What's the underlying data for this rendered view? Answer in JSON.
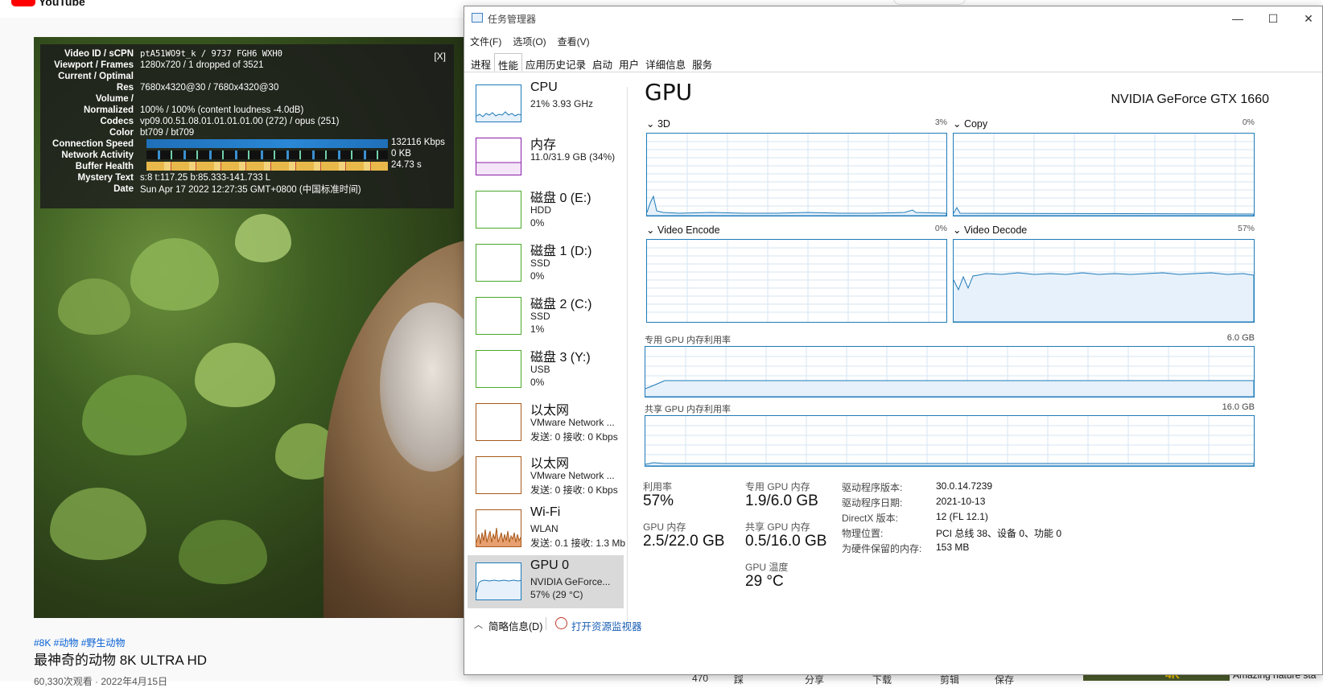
{
  "youtube": {
    "logo_text": "YouTube",
    "tags": "#8K #动物 #野生动物",
    "video_title": "最神奇的动物 8K ULTRA HD",
    "meta": "60,330次观看 · 2022年4月15日",
    "actions": {
      "likes": "470",
      "dislike": "踩",
      "share": "分享",
      "download": "下载",
      "clip": "剪辑",
      "save": "保存"
    },
    "suggested_title": "Amazing nature sta",
    "suggested_badge": "4K",
    "stats_overlay": {
      "close": "[X]",
      "rows": [
        {
          "label": "Video ID / sCPN",
          "value": "ptA51WO9t_k / 9737 FGH6 WXH0"
        },
        {
          "label": "Viewport / Frames",
          "value": "1280x720 / 1 dropped of 3521"
        },
        {
          "label": "Current / Optimal",
          "value": ""
        },
        {
          "label": "Res",
          "value": "7680x4320@30 / 7680x4320@30"
        },
        {
          "label": "Volume /",
          "value": ""
        },
        {
          "label": "Normalized",
          "value": "100% / 100% (content loudness -4.0dB)"
        },
        {
          "label": "Codecs",
          "value": "vp09.00.51.08.01.01.01.01.00 (272) / opus (251)"
        },
        {
          "label": "Color",
          "value": "bt709 / bt709"
        },
        {
          "label": "Connection Speed",
          "value": "132116 Kbps"
        },
        {
          "label": "Network Activity",
          "value": "0 KB"
        },
        {
          "label": "Buffer Health",
          "value": "24.73 s"
        },
        {
          "label": "Mystery Text",
          "value": "s:8 t:117.25 b:85.333-141.733 L"
        },
        {
          "label": "Date",
          "value": "Sun Apr 17 2022 12:27:35 GMT+0800 (中国标准时间)"
        }
      ]
    }
  },
  "taskmgr": {
    "title": "任务管理器",
    "window_buttons": {
      "minimize": "—",
      "maximize": "☐",
      "close": "✕"
    },
    "menu": [
      "文件(F)",
      "选项(O)",
      "查看(V)"
    ],
    "tabs": [
      "进程",
      "性能",
      "应用历史记录",
      "启动",
      "用户",
      "详细信息",
      "服务"
    ],
    "active_tab": "性能",
    "resources": [
      {
        "name": "CPU",
        "lines": [
          "21% 3.93 GHz"
        ],
        "color": "#1e7ab8"
      },
      {
        "name": "内存",
        "lines": [
          "11.0/31.9 GB (34%)"
        ],
        "color": "#8b1ea8"
      },
      {
        "name": "磁盘 0 (E:)",
        "lines": [
          "HDD",
          "0%"
        ],
        "color": "#4aa82a"
      },
      {
        "name": "磁盘 1 (D:)",
        "lines": [
          "SSD",
          "0%"
        ],
        "color": "#4aa82a"
      },
      {
        "name": "磁盘 2 (C:)",
        "lines": [
          "SSD",
          "1%"
        ],
        "color": "#4aa82a"
      },
      {
        "name": "磁盘 3 (Y:)",
        "lines": [
          "USB",
          "0%"
        ],
        "color": "#4aa82a"
      },
      {
        "name": "以太网",
        "lines": [
          "VMware Network ...",
          "发送: 0 接收: 0 Kbps"
        ],
        "color": "#a75a1c"
      },
      {
        "name": "以太网",
        "lines": [
          "VMware Network ...",
          "发送: 0 接收: 0 Kbps"
        ],
        "color": "#a75a1c"
      },
      {
        "name": "Wi-Fi",
        "lines": [
          "WLAN",
          "发送: 0.1 接收: 1.3 Mb"
        ],
        "color": "#a75a1c"
      },
      {
        "name": "GPU 0",
        "lines": [
          "NVIDIA GeForce...",
          "57% (29 °C)"
        ],
        "color": "#1e7ab8"
      }
    ],
    "gpu": {
      "heading": "GPU",
      "model": "NVIDIA GeForce GTX 1660",
      "engines": [
        {
          "label": "3D",
          "pct": "3%"
        },
        {
          "label": "Copy",
          "pct": "0%"
        },
        {
          "label": "Video Encode",
          "pct": "0%"
        },
        {
          "label": "Video Decode",
          "pct": "57%"
        }
      ],
      "dedicated_label": "专用 GPU 内存利用率",
      "dedicated_max": "6.0 GB",
      "shared_label": "共享 GPU 内存利用率",
      "shared_max": "16.0 GB",
      "stats": {
        "utilization_k": "利用率",
        "utilization_v": "57%",
        "dedicated_k": "专用 GPU 内存",
        "dedicated_v": "1.9/6.0 GB",
        "gpu_mem_k": "GPU 内存",
        "gpu_mem_v": "2.5/22.0 GB",
        "shared_k": "共享 GPU 内存",
        "shared_v": "0.5/16.0 GB",
        "temp_k": "GPU 温度",
        "temp_v": "29 °C"
      },
      "info": [
        {
          "k": "驱动程序版本:",
          "v": "30.0.14.7239"
        },
        {
          "k": "驱动程序日期:",
          "v": "2021-10-13"
        },
        {
          "k": "DirectX 版本:",
          "v": "12 (FL 12.1)"
        },
        {
          "k": "物理位置:",
          "v": "PCI 总线 38、设备 0、功能 0"
        },
        {
          "k": "为硬件保留的内存:",
          "v": "153 MB"
        }
      ]
    },
    "footer": {
      "chevron": "︿",
      "less_details": "简略信息(D)",
      "open_monitor": "打开资源监视器"
    }
  }
}
